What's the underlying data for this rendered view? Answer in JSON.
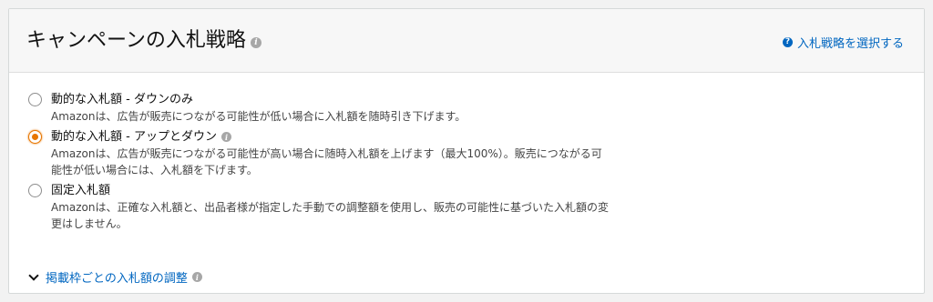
{
  "header": {
    "title": "キャンペーンの入札戦略",
    "help_link": "入札戦略を選択する"
  },
  "options": [
    {
      "label": "動的な入札額 - ダウンのみ",
      "description": "Amazonは、広告が販売につながる可能性が低い場合に入札額を随時引き下げます。",
      "selected": false
    },
    {
      "label": "動的な入札額 - アップとダウン",
      "description": "Amazonは、広告が販売につながる可能性が高い場合に随時入札額を上げます（最大100%）。販売につながる可能性が低い場合には、入札額を下げます。",
      "selected": true
    },
    {
      "label": "固定入札額",
      "description": "Amazonは、正確な入札額と、出品者様が指定した手動での調整額を使用し、販売の可能性に基づいた入札額の変更はしません。",
      "selected": false
    }
  ],
  "placement_adjust": {
    "label": "掲載枠ごとの入札額の調整"
  },
  "colors": {
    "link": "#0066c0",
    "radio_selected": "#e77600",
    "header_bg": "#f7f7f7"
  }
}
